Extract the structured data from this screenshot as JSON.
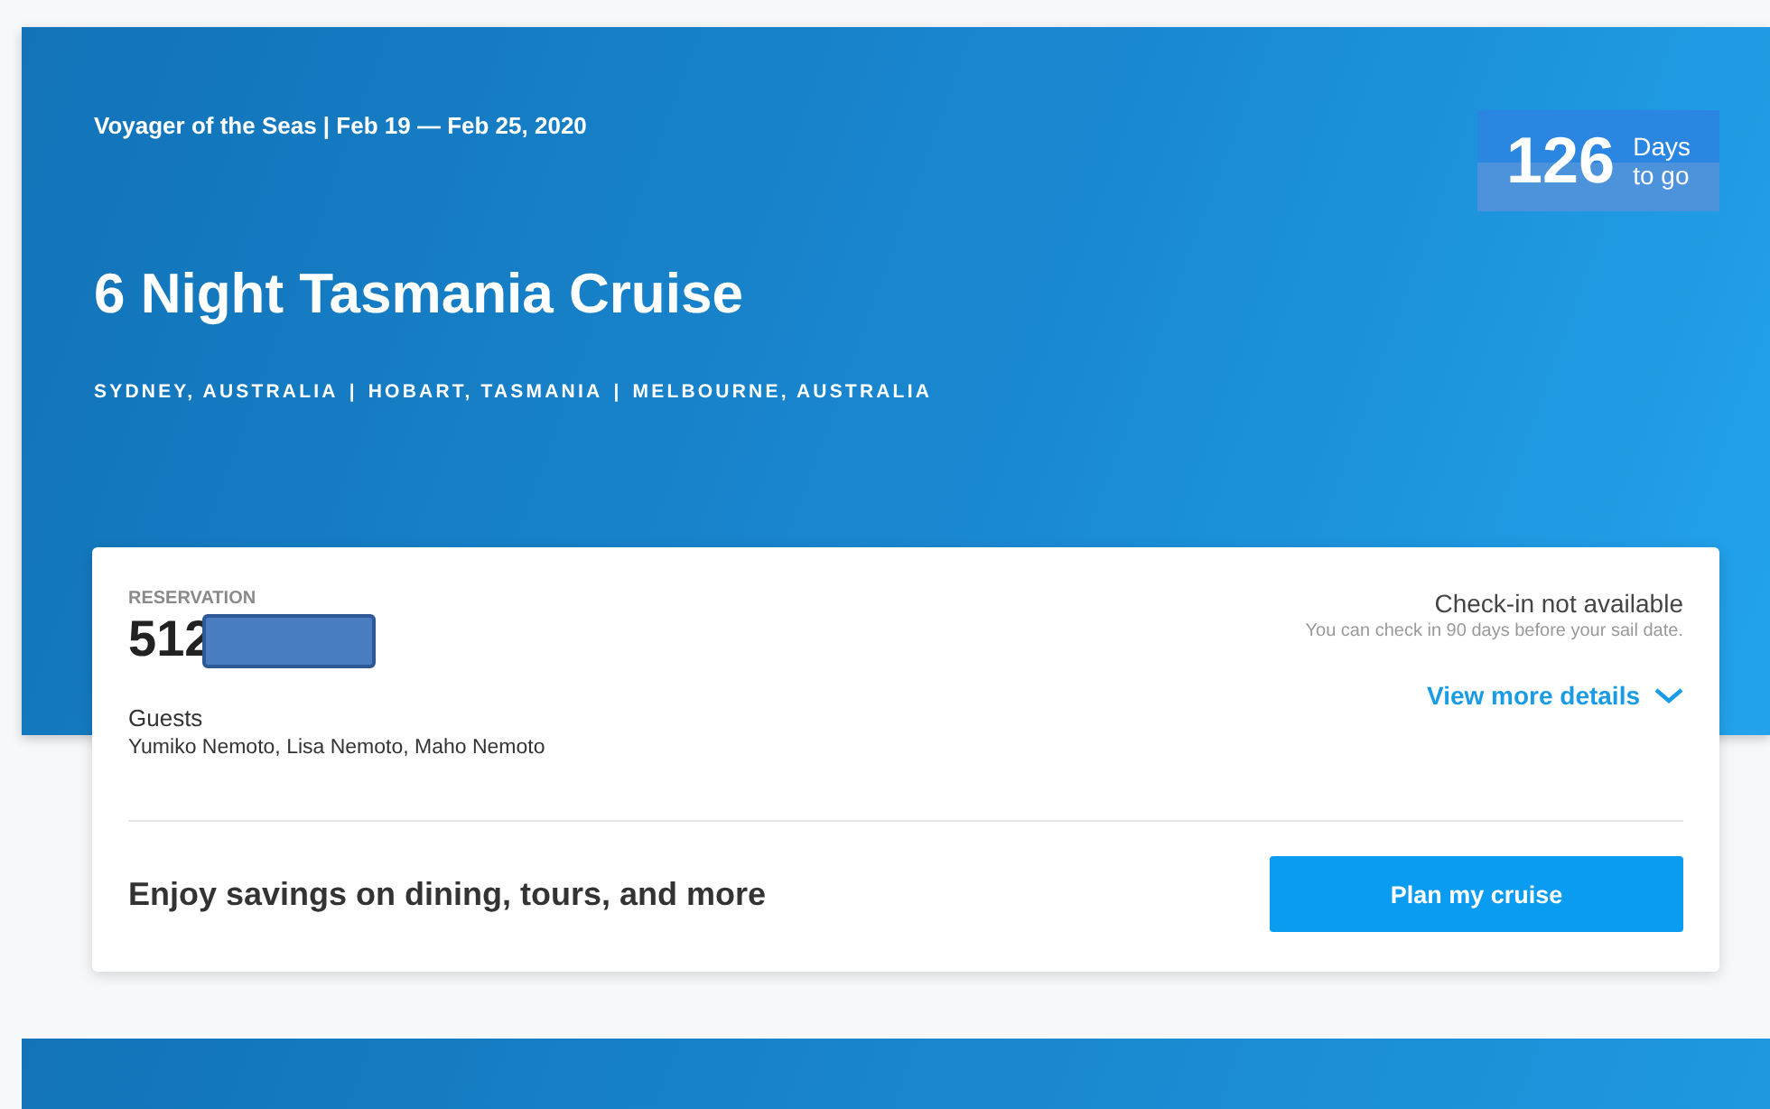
{
  "cruise": {
    "ship": "Voyager of the Seas",
    "ship_separator": "|",
    "dates": "Feb 19 — Feb 25, 2020",
    "title": "6 Night Tasmania Cruise",
    "ports": [
      "SYDNEY, AUSTRALIA",
      "HOBART, TASMANIA",
      "MELBOURNE, AUSTRALIA"
    ],
    "port_separators": [
      "|",
      "|"
    ],
    "countdown": {
      "number": "126",
      "unit_top": "Days",
      "unit_bottom": "to go"
    }
  },
  "reservation": {
    "label": "RESERVATION",
    "number": "512",
    "redacted": true,
    "guests_label": "Guests",
    "guests": "Yumiko Nemoto, Lisa Nemoto, Maho Nemoto",
    "checkin_status": "Check-in not available",
    "checkin_note": "You can check in 90 days before your sail date.",
    "details_link": "View more details",
    "promo": "Enjoy savings on dining, tours, and more",
    "plan_button": "Plan my cruise"
  }
}
